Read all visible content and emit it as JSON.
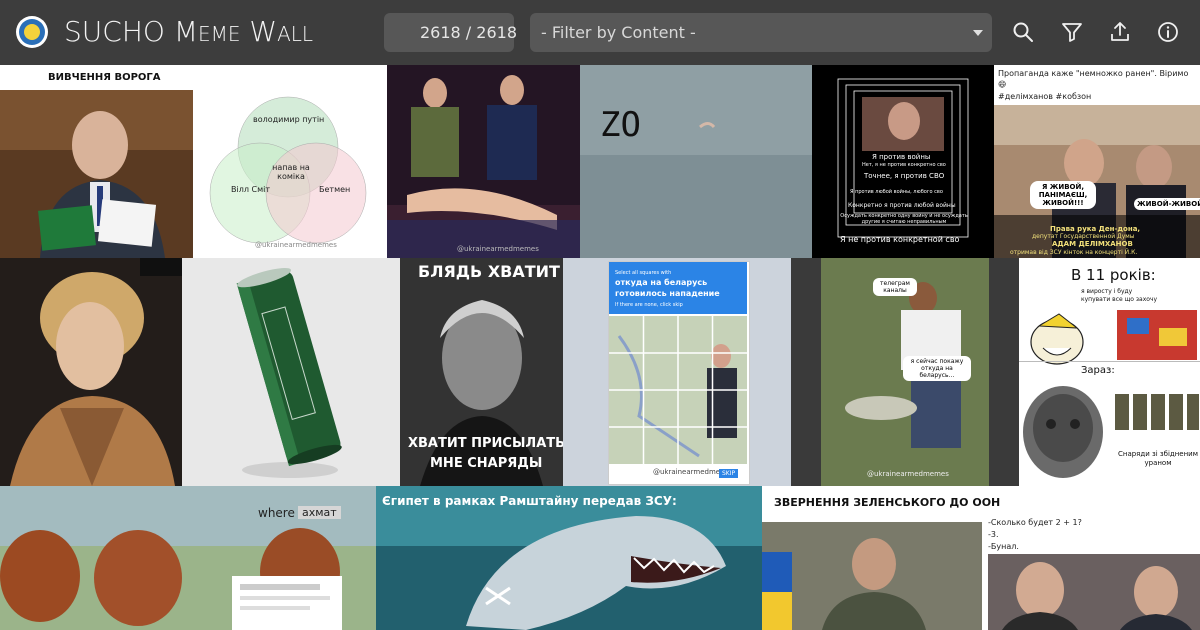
{
  "app": {
    "title_prefix": "SUCHO",
    "title_rest": "Meme Wall",
    "counter": "2618 / 2618",
    "filter_placeholder": "- Filter by Content -"
  },
  "icons": {
    "search": "search-icon",
    "filter": "funnel-icon",
    "upload": "upload-icon",
    "info": "info-icon"
  },
  "colors": {
    "topbar": "#3d3d3d",
    "control": "#575757",
    "text": "#f2f2f2"
  },
  "memes": {
    "m1": {
      "caption": "ВИВЧЕННЯ ВОРОГА"
    },
    "m2": {
      "c1": "володимир путін",
      "c2": "Вілл Сміт",
      "c3": "Бетмен",
      "center": "напав на коміка",
      "wm": "@ukrainearmedmemes"
    },
    "m3": {
      "wm": "@ukrainearmedmemes"
    },
    "m4": {
      "caption": "ZO"
    },
    "m5": {
      "l1": "Я против войны",
      "l2": "Нет, я не против конкретно сво",
      "l3": "Точнее, я против СВО",
      "l4": "Я против любой войны, любого сво",
      "l5": "Конкретно я против любой войны",
      "l6": "Осуждать конкретно одну войну и не осуждать другие я считаю неправильным",
      "bottom": "Я не против конкретной сво"
    },
    "m6": {
      "text": "Пропаганда каже \"немножко ранен\". Віримо 😄",
      "tags": "#делімханов #кобзон",
      "b1": "Я ЖИВОЙ, ПАНІМАЄШ, ЖИВОЙ!!!",
      "b2": "ЖИВОЙ-ЖИВОЙ…",
      "bottom1": "Права рука Ден-дона,",
      "bottom2": "депутат Государственной Думы",
      "bottom3": "АДАМ ДЕЛІМХАНОВ",
      "bottom4": "отримав від ЗСУ кінток на концерті Й.К."
    },
    "m9": {
      "top": "БЛЯДЬ ХВАТИТ",
      "bottom1": "ХВАТИТ ПРИСЫЛАТЬ",
      "bottom2": "МНЕ СНАРЯДЫ"
    },
    "m10": {
      "l1": "Select all squares with",
      "l2": "откуда на беларусь",
      "l3": "готовилось нападение",
      "l4": "If there are none, click skip",
      "wm": "@ukrainearmedmemes",
      "skip": "SKIP"
    },
    "m11": {
      "b1": "телеграм каналы",
      "b2": "я сейчас покажу откуда на беларусь…",
      "wm": "@ukrainearmedmemes"
    },
    "m12": {
      "title": "В 11 років:",
      "sub": "я виросту і буду купувати все що захочу",
      "now": "Зараз:",
      "ammo": "Снаряди зі збідненим ураном"
    },
    "m13": {
      "where": "where",
      "name": "ахмат"
    },
    "m14": {
      "caption": "Єгипет в рамках Рамштайну передав ЗСУ:"
    },
    "m15": {
      "caption": "ЗВЕРНЕННЯ ЗЕЛЕНСЬКОГО ДО ООН",
      "l1": "-Сколько будет 2 + 1?",
      "l2": "-3.",
      "l3": "-Бунал."
    }
  }
}
